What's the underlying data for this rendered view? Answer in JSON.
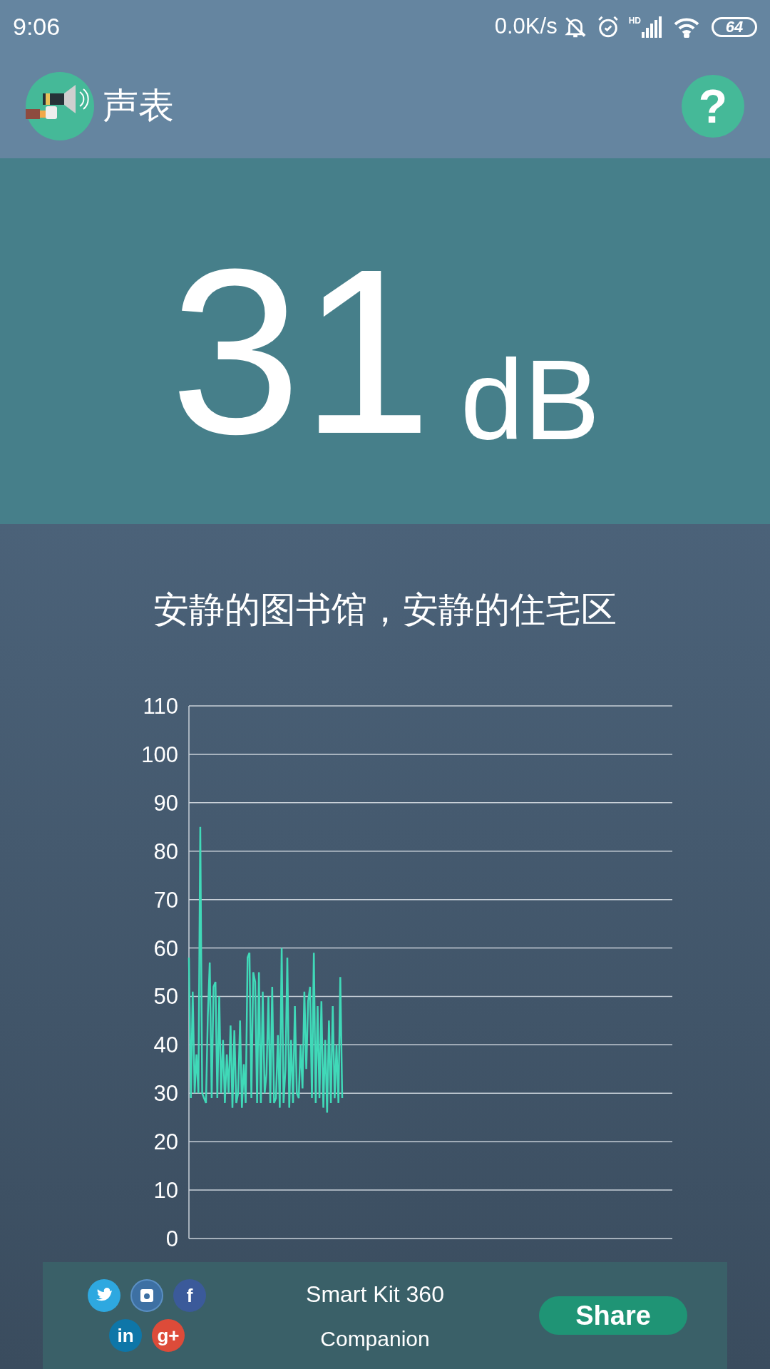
{
  "status_bar": {
    "time": "9:06",
    "net_speed": "0.0K/s",
    "network_label": "HD",
    "battery": "64"
  },
  "app_bar": {
    "title": "声表",
    "help": "?"
  },
  "reading": {
    "value": "31",
    "unit": "dB"
  },
  "description": "安静的图书馆，安静的住宅区",
  "history_graph": {
    "y_axis_labels": [
      "110",
      "100",
      "90",
      "80",
      "70",
      "60",
      "50",
      "40",
      "30",
      "20",
      "10",
      "0"
    ]
  },
  "footer": {
    "social": [
      {
        "kind": "twitter"
      },
      {
        "kind": "instagram"
      },
      {
        "kind": "facebook",
        "glyph": "f"
      },
      {
        "kind": "linkedin",
        "glyph": "in"
      },
      {
        "kind": "googleplus",
        "glyph": "g+"
      }
    ],
    "promo_line_1": "Smart Kit 360",
    "promo_line_2": "Companion",
    "share": "Share"
  }
}
